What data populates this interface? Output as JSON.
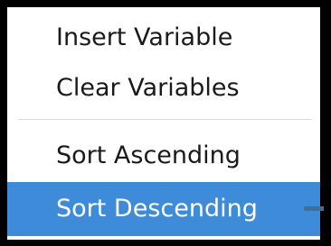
{
  "context_menu": {
    "items": [
      {
        "label": "Insert Variable",
        "highlighted": false
      },
      {
        "label": "Clear Variables",
        "highlighted": false
      },
      {
        "label": "Sort Ascending",
        "highlighted": false
      },
      {
        "label": "Sort Descending",
        "highlighted": true
      }
    ]
  },
  "colors": {
    "highlight": "#3d8bd9",
    "frame": "#000000",
    "background": "#ffffff",
    "separator": "#dcdcdc"
  },
  "icons": {
    "pointer": "mouse-pointer-icon"
  }
}
